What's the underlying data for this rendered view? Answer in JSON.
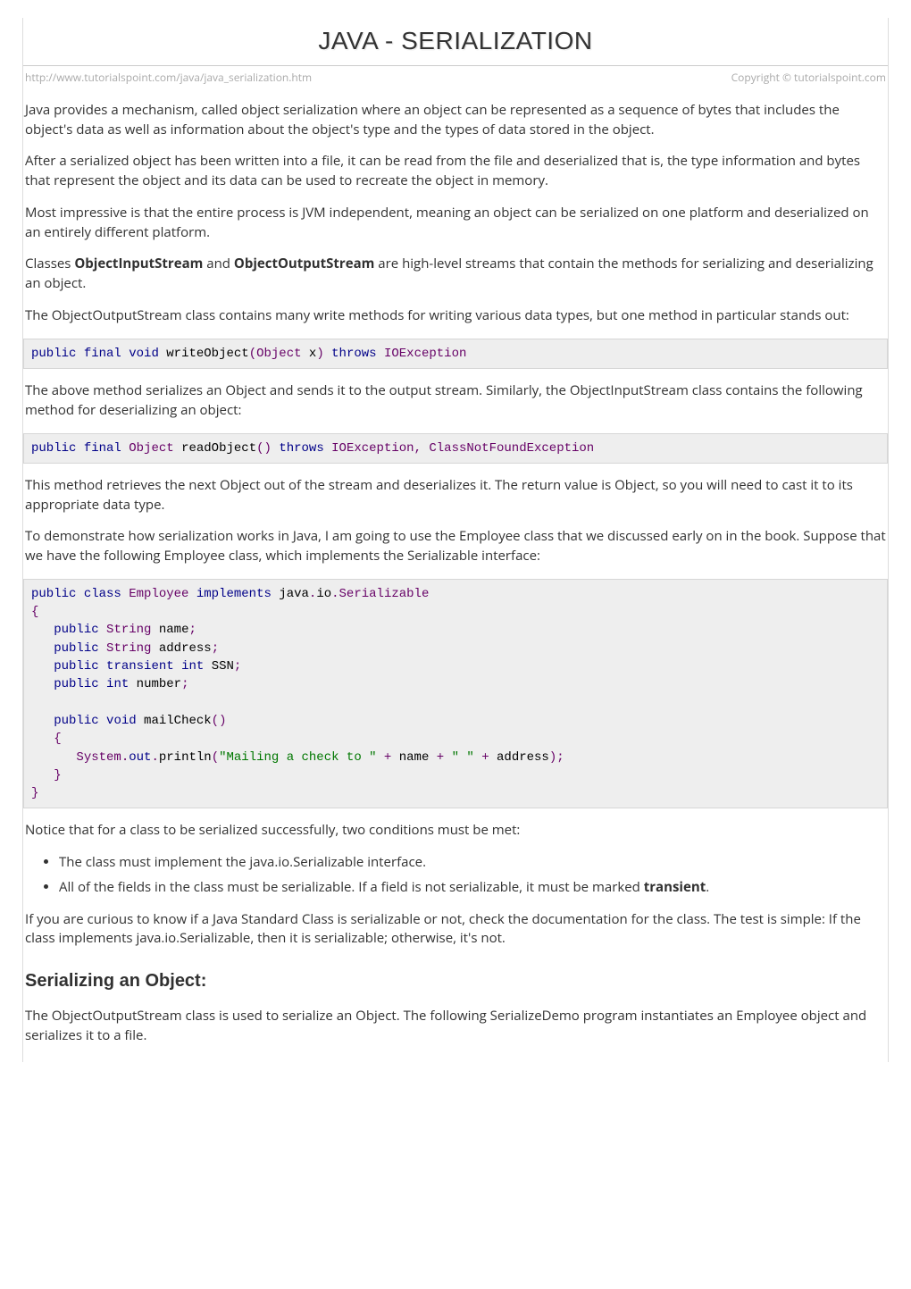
{
  "header": {
    "title": "JAVA - SERIALIZATION",
    "url": "http://www.tutorialspoint.com/java/java_serialization.htm",
    "copyright": "Copyright © tutorialspoint.com"
  },
  "paragraphs": {
    "intro1": "Java provides a mechanism, called object serialization where an object can be represented as a sequence of bytes that includes the object's data as well as information about the object's type and the types of data stored in the object.",
    "intro2": "After a serialized object has been written into a file, it can be read from the file and deserialized that is, the type information and bytes that represent the object and its data can be used to recreate the object in memory.",
    "intro3": "Most impressive is that the entire process is JVM independent, meaning an object can be serialized on one platform and deserialized on an entirely different platform.",
    "classes_pre": "Classes ",
    "ois": "ObjectInputStream",
    "and": " and ",
    "oos": "ObjectOutputStream",
    "classes_post": " are high-level streams that contain the methods for serializing and deserializing an object.",
    "write_methods": "The ObjectOutputStream class contains many write methods for writing various data types, but one method in particular stands out:",
    "above_method": "The above method serializes an Object and sends it to the output stream. Similarly, the ObjectInputStream class contains the following method for deserializing an object:",
    "this_method": "This method retrieves the next Object out of the stream and deserializes it. The return value is Object, so you will need to cast it to its appropriate data type.",
    "to_demo": "To demonstrate how serialization works in Java, I am going to use the Employee class that we discussed early on in the book. Suppose that we have the following Employee class, which implements the Serializable interface:",
    "notice": "Notice that for a class to be serialized successfully, two conditions must be met:",
    "bullet1": "The class must implement the java.io.Serializable interface.",
    "bullet2_pre": "All of the fields in the class must be serializable. If a field is not serializable, it must be marked ",
    "transient": "transient",
    "bullet2_post": ".",
    "curious": "If you are curious to know if a Java Standard Class is serializable or not, check the documentation for the class. The test is simple: If the class implements java.io.Serializable, then it is serializable; otherwise, it's not.",
    "h2_serializing": "Serializing an Object:",
    "serializing_p": "The ObjectOutputStream class is used to serialize an Object. The following SerializeDemo program instantiates an Employee object and serializes it to a file."
  },
  "code": {
    "writeObject": {
      "kw_public": "public",
      "kw_final": "final",
      "kw_void": "void",
      "fn": "writeObject",
      "lp": "(",
      "type_obj": "Object",
      "arg": " x",
      "rp": ")",
      "kw_throws": "throws",
      "exc": "IOException"
    },
    "readObject": {
      "kw_public": "public",
      "kw_final": "final",
      "type_obj": "Object",
      "fn": "readObject",
      "lp": "(",
      "rp": ")",
      "kw_throws": "throws",
      "exc1": "IOException",
      "comma": ",",
      "exc2": "ClassNotFoundException"
    },
    "employee": {
      "l1_public": "public",
      "l1_class": "class",
      "l1_name": "Employee",
      "l1_impl": "implements",
      "l1_pkg": "java",
      "l1_dot1": ".",
      "l1_io": "io",
      "l1_dot2": ".",
      "l1_ser": "Serializable",
      "l2": "{",
      "l3_public": "public",
      "l3_type": "String",
      "l3_name": " name",
      "l3_semi": ";",
      "l4_public": "public",
      "l4_type": "String",
      "l4_name": " address",
      "l4_semi": ";",
      "l5_public": "public",
      "l5_trans": "transient",
      "l5_int": "int",
      "l5_name": " SSN",
      "l5_semi": ";",
      "l6_public": "public",
      "l6_int": "int",
      "l6_name": " number",
      "l6_semi": ";",
      "l8_public": "public",
      "l8_void": "void",
      "l8_fn": " mailCheck",
      "l8_lp": "()",
      "l9": "{",
      "l10_sys": "System",
      "l10_d1": ".",
      "l10_out": "out",
      "l10_d2": ".",
      "l10_println": "println",
      "l10_lp": "(",
      "l10_str1": "\"Mailing a check to \"",
      "l10_plus1": " + ",
      "l10_name": "name",
      "l10_plus2": " + ",
      "l10_str2": "\" \"",
      "l10_plus3": " + ",
      "l10_addr": "address",
      "l10_rp": ");",
      "l11": "}",
      "l12": "}"
    }
  }
}
